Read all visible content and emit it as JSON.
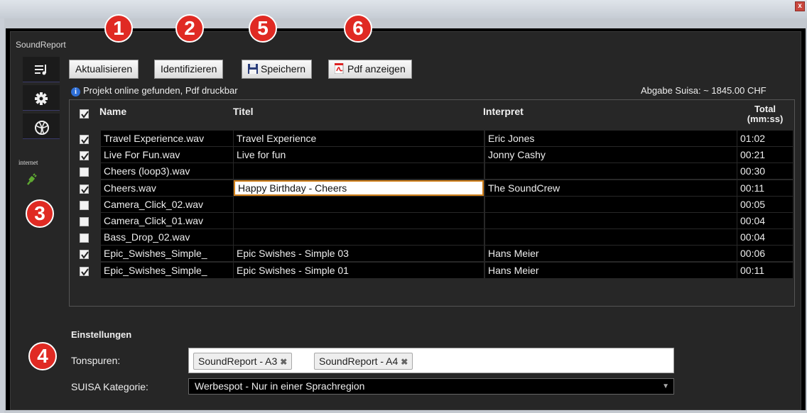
{
  "window": {
    "close_glyph": "x",
    "app_title": "SoundReport"
  },
  "sidebar": [
    {
      "icon": "playlist-icon"
    },
    {
      "icon": "gear-icon"
    },
    {
      "icon": "globe-icon"
    }
  ],
  "status": {
    "label": "internet",
    "icon": "plug-connected-icon"
  },
  "toolbar": {
    "refresh": "Aktualisieren",
    "identify": "Identifizieren",
    "save": "Speichern",
    "pdf": "Pdf anzeigen"
  },
  "info": {
    "message": "Projekt online gefunden, Pdf druckbar",
    "suisa_fee": "Abgabe Suisa: ~ 1845.00 CHF"
  },
  "table": {
    "headers": {
      "name": "Name",
      "title": "Titel",
      "artist": "Interpret",
      "total": "Total",
      "total_unit": "(mm:ss)"
    },
    "rows": [
      {
        "checked": true,
        "name": "Travel Experience.wav",
        "title": "Travel Experience",
        "artist": "Eric Jones",
        "total": "01:02"
      },
      {
        "checked": true,
        "name": "Live For Fun.wav",
        "title": "Live for fun",
        "artist": "Jonny Cashy",
        "total": "00:21"
      },
      {
        "checked": false,
        "name": "Cheers (loop3).wav",
        "title": "",
        "artist": "",
        "total": "00:30"
      },
      {
        "checked": true,
        "name": "Cheers.wav",
        "title": "Happy Birthday - Cheers",
        "artist": "The SoundCrew",
        "total": "00:11",
        "editing": true
      },
      {
        "checked": false,
        "name": "Camera_Click_02.wav",
        "title": "",
        "artist": "",
        "total": "00:05"
      },
      {
        "checked": false,
        "name": "Camera_Click_01.wav",
        "title": "",
        "artist": "",
        "total": "00:04"
      },
      {
        "checked": false,
        "name": "Bass_Drop_02.wav",
        "title": "",
        "artist": "",
        "total": "00:04"
      },
      {
        "checked": true,
        "name": "Epic_Swishes_Simple_",
        "title": "Epic Swishes - Simple 03",
        "artist": "Hans Meier",
        "total": "00:06"
      },
      {
        "checked": true,
        "name": "Epic_Swishes_Simple_",
        "title": "Epic Swishes - Simple 01",
        "artist": "Hans Meier",
        "total": "00:11"
      }
    ]
  },
  "settings": {
    "title": "Einstellungen",
    "tracks_label": "Tonspuren:",
    "tracks": [
      "SoundReport - A3",
      "SoundReport - A4"
    ],
    "category_label": "SUISA Kategorie:",
    "category_value": "Werbespot - Nur in einer Sprachregion"
  },
  "callouts": [
    "1",
    "2",
    "5",
    "6",
    "3",
    "4"
  ],
  "colors": {
    "callout": "#e02a23",
    "edit_border": "#d07f19",
    "info": "#2f6fd6"
  }
}
